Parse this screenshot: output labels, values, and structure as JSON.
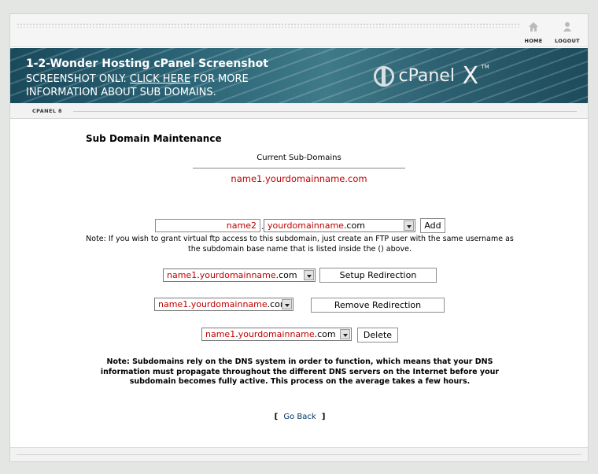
{
  "nav": {
    "home_label": "HOME",
    "logout_label": "LOGOUT"
  },
  "banner": {
    "title": "1-2-Wonder Hosting cPanel Screenshot",
    "line2_prefix": "SCREENSHOT ONLY.",
    "link_text": "CLICK HERE",
    "line2_suffix": "FOR MORE",
    "line3": "INFORMATION ABOUT SUB DOMAINS.",
    "logo_text": "cPanel",
    "logo_x": "X",
    "logo_tm": "TM"
  },
  "section_label": "CPANEL 8",
  "page_title": "Sub Domain Maintenance",
  "current": {
    "label": "Current Sub-Domains",
    "items": [
      "name1.yourdomainname.com"
    ]
  },
  "add_form": {
    "subdomain_value": "name2",
    "separator": ".",
    "domain_select": {
      "red": "yourdomainname",
      "rest": ".com"
    },
    "add_label": "Add"
  },
  "ftp_note": "Note: If you wish to grant virtual ftp access to this subdomain, just create an FTP user with the same username as the subdomain base name that is listed inside the () above.",
  "redirect": {
    "select": {
      "red1": "name1",
      "dot": ".",
      "red2": "yourdomainname",
      "rest": ".com"
    },
    "button_label": "Setup Redirection"
  },
  "remove": {
    "select": {
      "red1": "name1",
      "dot": ".",
      "red2": "yourdomainname",
      "rest": ".com"
    },
    "button_label": "Remove Redirection"
  },
  "delete": {
    "select": {
      "red1": "name1",
      "dot": ".",
      "red2": "yourdomainname",
      "rest": ".com"
    },
    "button_label": "Delete"
  },
  "dns_note": "Note: Subdomains rely on the DNS system in order to function, which means that your DNS information must propagate throughout the different DNS servers on the Internet before your subdomain becomes fully active. This process on the average takes a few hours.",
  "go_back": {
    "open": "[",
    "label": "Go Back",
    "close": "]"
  },
  "colors": {
    "accent_red": "#c00000",
    "banner": "#2a6476"
  }
}
